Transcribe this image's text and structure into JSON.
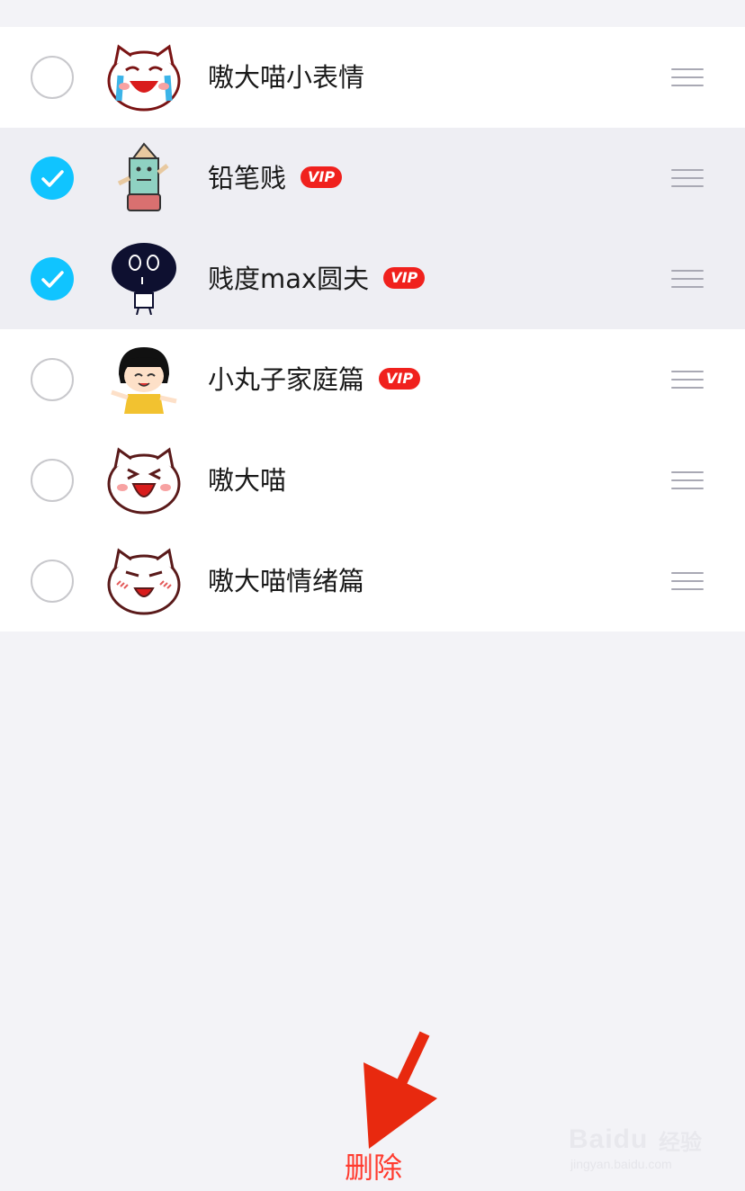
{
  "sticker_list": {
    "items": [
      {
        "name": "嗷大喵小表情",
        "selected": false,
        "vip": false,
        "badge": ""
      },
      {
        "name": "铅笔贱",
        "selected": true,
        "vip": true,
        "badge": "VIP"
      },
      {
        "name": "贱度max圆夫",
        "selected": true,
        "vip": true,
        "badge": "VIP"
      },
      {
        "name": "小丸子家庭篇",
        "selected": false,
        "vip": true,
        "badge": "VIP"
      },
      {
        "name": "嗷大喵",
        "selected": false,
        "vip": false,
        "badge": ""
      },
      {
        "name": "嗷大喵情绪篇",
        "selected": false,
        "vip": false,
        "badge": ""
      }
    ]
  },
  "footer": {
    "delete_label": "删除"
  },
  "watermark": {
    "brand": "Baidu",
    "brand_cn": "经验",
    "url": "jingyan.baidu.com"
  },
  "colors": {
    "accent_check": "#10c4ff",
    "vip_badge": "#f0211d",
    "delete_text": "#ff3b2f",
    "arrow": "#e8290f",
    "selected_row_bg": "#eeeef3",
    "page_bg": "#f3f3f7"
  },
  "icons": {
    "checkbox": "circle-checkbox-icon",
    "drag_handle": "drag-handle-icon",
    "annotation": "red-arrow-annotation"
  }
}
